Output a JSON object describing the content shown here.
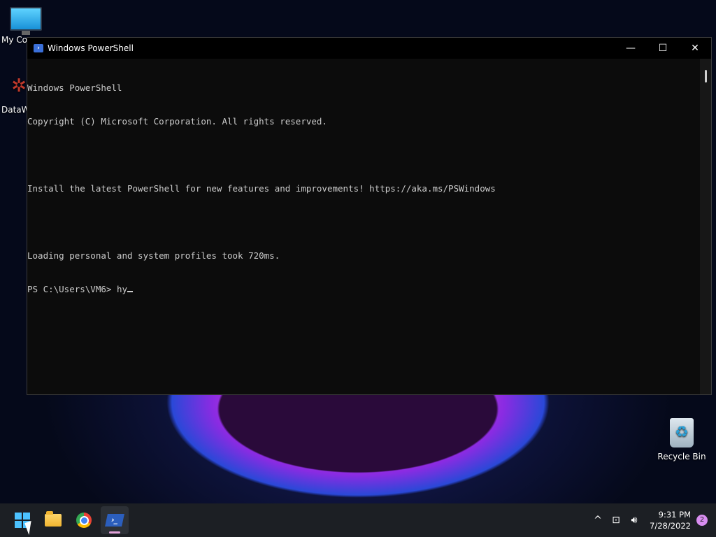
{
  "desktop": {
    "icons": [
      {
        "label": "My Co"
      },
      {
        "label": "DataW"
      },
      {
        "label": "Recycle Bin"
      }
    ]
  },
  "window": {
    "title": "Windows PowerShell",
    "controls": {
      "minimize": "—",
      "maximize": "☐",
      "close": "✕"
    },
    "console_lines": [
      "Windows PowerShell",
      "Copyright (C) Microsoft Corporation. All rights reserved.",
      "",
      "Install the latest PowerShell for new features and improvements! https://aka.ms/PSWindows",
      "",
      "Loading personal and system profiles took 720ms."
    ],
    "prompt": "PS C:\\Users\\VM6> ",
    "input": "hy"
  },
  "taskbar": {
    "apps": [
      {
        "name": "start"
      },
      {
        "name": "file-explorer"
      },
      {
        "name": "chrome"
      },
      {
        "name": "powershell",
        "active": true
      }
    ],
    "tray": {
      "chevron": "^",
      "time": "9:31 PM",
      "date": "7/28/2022",
      "notifications": "2"
    }
  },
  "colors": {
    "console_bg": "#0c0c0c",
    "console_text": "#cccccc",
    "taskbar_bg": "#1c1f24",
    "accent": "#4cc2ff"
  }
}
